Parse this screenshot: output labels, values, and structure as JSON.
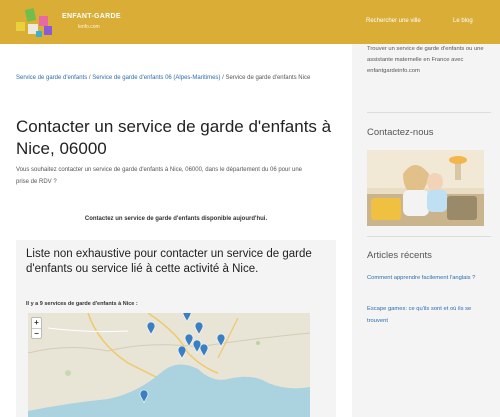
{
  "header": {
    "logo_text": "ENFANT-GARDE",
    "logo_sub": "lenfo.com",
    "nav": [
      "Rechercher une ville",
      "Le blog"
    ]
  },
  "breadcrumb": {
    "link1": "Service de garde d'enfants",
    "sep": " / ",
    "link2": "Service de garde d'enfants 06 (Alpes-Maritimes)",
    "current": "Service de garde d'enfants Nice"
  },
  "main": {
    "title": "Contacter un service de garde d'enfants à Nice, 06000",
    "intro": "Vous souhaitez contacter un service de garde d'enfants à Nice, 06000, dans le département du 06 pour une prise de RDV ?",
    "cta": "Contactez un service de garde d'enfants disponible aujourd'hui.",
    "list_title": "Liste non exhaustive pour contacter un service de garde d'enfants ou service lié à cette activité à Nice.",
    "list_count": "Il y a 9 services de garde d'enfants à Nice :",
    "map": {
      "zoom_in": "+",
      "zoom_out": "−",
      "land_color": "#e8e4d6",
      "sea_color": "#aad3df",
      "marker_color": "#3a7fc1",
      "marker_count": 9
    }
  },
  "sidebar": {
    "search_text": "Trouver un service de garde d'enfants ou une assistante maternelle en France avec enfantgardeinfo.com",
    "contact_heading": "Contactez-nous",
    "articles_heading": "Articles récents",
    "articles": [
      "Comment apprendre facilement l'anglais ?",
      "Escape games: ce qu'ils sont et où ils se trouvent"
    ]
  },
  "colors": {
    "header": "#d9ad36",
    "link": "#2b6cb0"
  }
}
